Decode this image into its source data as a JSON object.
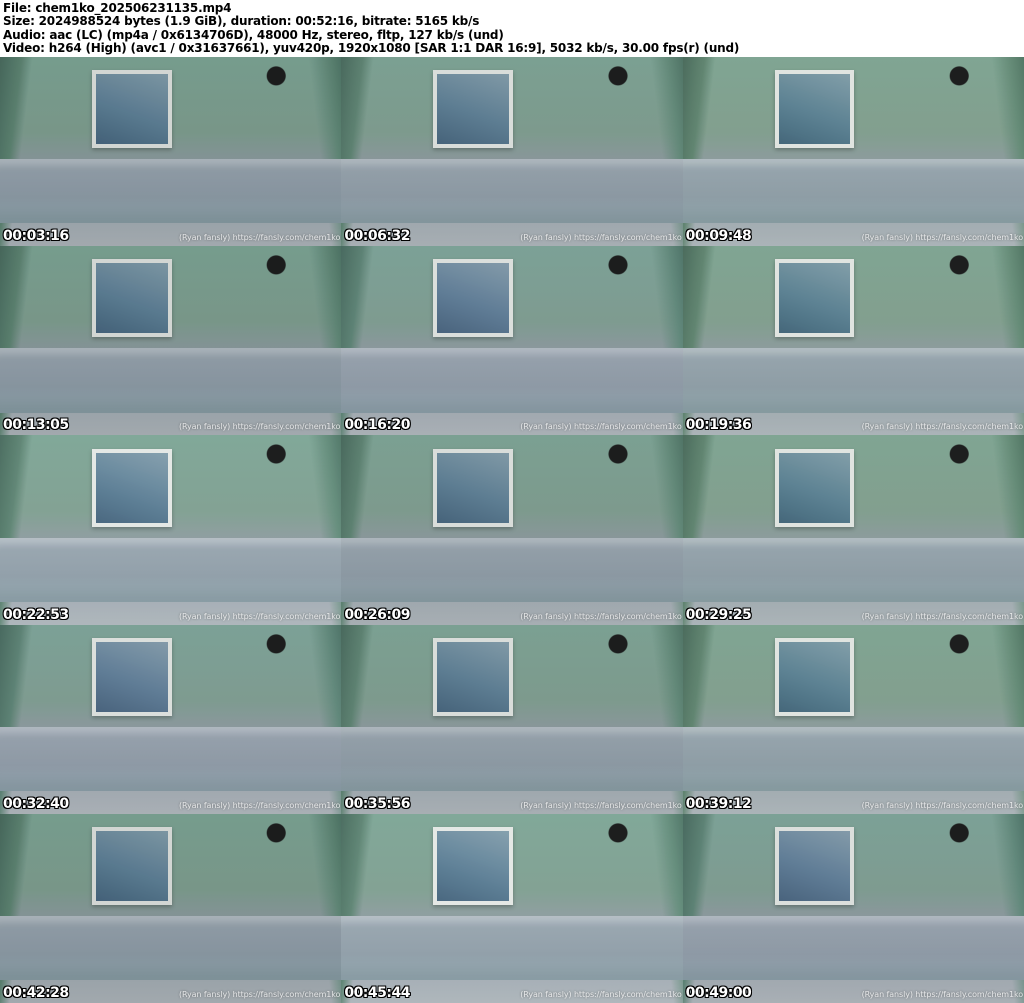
{
  "header": {
    "file_line": "File: chem1ko_202506231135.mp4",
    "size_line": "Size: 2024988524 bytes (1.9 GiB), duration: 00:52:16, bitrate: 5165 kb/s",
    "audio_line": "Audio: aac (LC) (mp4a / 0x6134706D), 48000 Hz, stereo, fltp, 127 kb/s (und)",
    "video_line": "Video: h264 (High) (avc1 / 0x31637661), yuv420p, 1920x1080 [SAR 1:1 DAR 16:9], 5032 kb/s, 30.00 fps(r) (und)"
  },
  "sheet": {
    "watermark": "(Ryan fansly) https://fansly.com/chem1ko",
    "thumbnails": [
      {
        "timestamp": "00:03:16"
      },
      {
        "timestamp": "00:06:32"
      },
      {
        "timestamp": "00:09:48"
      },
      {
        "timestamp": "00:13:05"
      },
      {
        "timestamp": "00:16:20"
      },
      {
        "timestamp": "00:19:36"
      },
      {
        "timestamp": "00:22:53"
      },
      {
        "timestamp": "00:26:09"
      },
      {
        "timestamp": "00:29:25"
      },
      {
        "timestamp": "00:32:40"
      },
      {
        "timestamp": "00:35:56"
      },
      {
        "timestamp": "00:39:12"
      },
      {
        "timestamp": "00:42:28"
      },
      {
        "timestamp": "00:45:44"
      },
      {
        "timestamp": "00:49:00"
      }
    ]
  }
}
